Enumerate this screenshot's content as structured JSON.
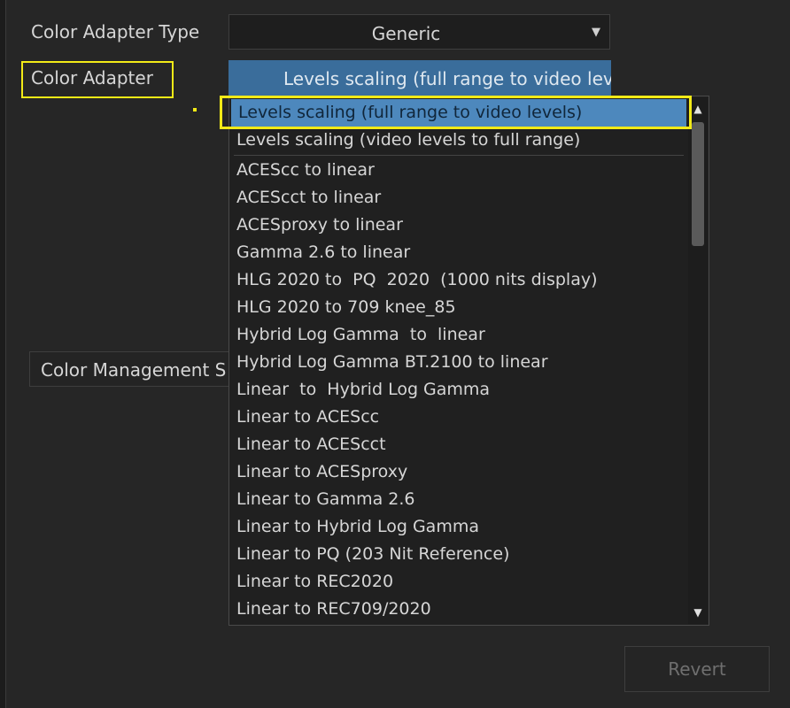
{
  "color_adapter_type": {
    "label": "Color Adapter Type",
    "value": "Generic"
  },
  "color_adapter": {
    "label": "Color Adapter",
    "value": "Levels scaling (full range to video lev"
  },
  "color_management": {
    "label": "Color Management S"
  },
  "dropdown": {
    "selected_index": 0,
    "items": [
      "Levels scaling (full range to video levels)",
      "Levels scaling (video levels to full range)",
      "ACEScc to linear",
      "ACEScct to linear",
      "ACESproxy to linear",
      "Gamma 2.6 to linear",
      "HLG 2020 to  PQ  2020  (1000 nits display)",
      "HLG 2020 to 709 knee_85",
      "Hybrid Log Gamma  to  linear",
      "Hybrid Log Gamma BT.2100 to linear",
      "Linear  to  Hybrid Log Gamma",
      "Linear to ACEScc",
      "Linear to ACEScct",
      "Linear to ACESproxy",
      "Linear to Gamma 2.6",
      "Linear to Hybrid Log Gamma",
      "Linear to PQ (203 Nit Reference)",
      "Linear to REC2020",
      "Linear to REC709/2020"
    ]
  },
  "revert_label": "Revert",
  "colors": {
    "highlight": "#f2ea17",
    "selection": "#4d88bd",
    "combo_active": "#3a6d9b",
    "background": "#262626"
  },
  "icons": {
    "combo_arrow": "triangle-down-icon",
    "scroll_up": "triangle-up-icon",
    "scroll_down": "triangle-down-icon"
  }
}
